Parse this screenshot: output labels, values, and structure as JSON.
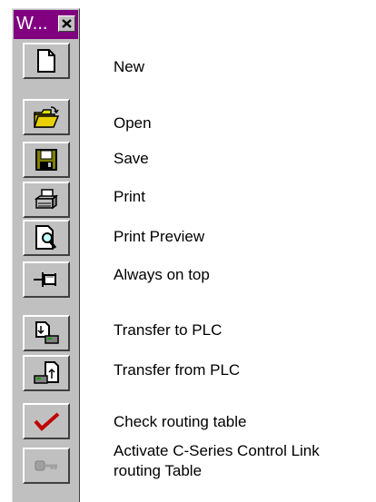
{
  "window": {
    "title": "W...",
    "title_bar_color": "#800080",
    "close_icon": "close-icon"
  },
  "buttons": [
    {
      "id": "new",
      "label": "New",
      "icon": "new-document-icon",
      "enabled": true
    },
    {
      "id": "open",
      "label": "Open",
      "icon": "open-folder-icon",
      "enabled": true
    },
    {
      "id": "save",
      "label": "Save",
      "icon": "floppy-disk-icon",
      "enabled": true
    },
    {
      "id": "print",
      "label": "Print",
      "icon": "printer-icon",
      "enabled": true
    },
    {
      "id": "print-preview",
      "label": "Print Preview",
      "icon": "print-preview-icon",
      "enabled": true
    },
    {
      "id": "always-on-top",
      "label": "Always on top",
      "icon": "pushpin-icon",
      "enabled": true
    },
    {
      "id": "transfer-to-plc",
      "label": "Transfer to PLC",
      "icon": "transfer-to-plc-icon",
      "enabled": true
    },
    {
      "id": "transfer-from-plc",
      "label": "Transfer from PLC",
      "icon": "transfer-from-plc-icon",
      "enabled": true
    },
    {
      "id": "check-routing-table",
      "label": "Check routing table",
      "icon": "checkmark-icon",
      "enabled": true
    },
    {
      "id": "activate-routing-table",
      "label": "Activate C-Series Control Link\nrouting Table",
      "icon": "key-icon",
      "enabled": false
    }
  ]
}
